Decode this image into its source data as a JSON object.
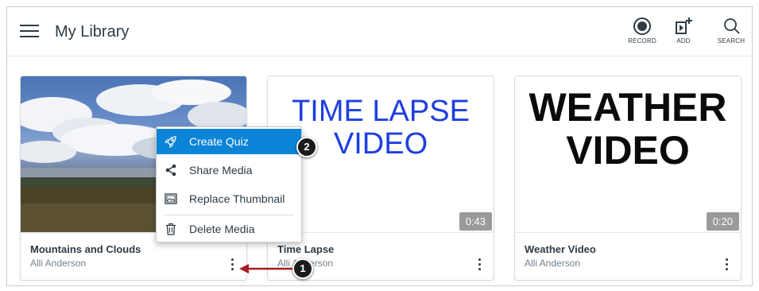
{
  "header": {
    "title": "My Library",
    "record_label": "RECORD",
    "add_label": "ADD",
    "search_label": "SEARCH"
  },
  "cards": [
    {
      "name": "Mountains and Clouds",
      "author": "Alli Anderson",
      "duration": ""
    },
    {
      "name": "Time Lapse",
      "author": "Alli Anderson",
      "duration": "0:43",
      "thumb_lines": [
        "TIME LAPSE",
        "VIDEO"
      ]
    },
    {
      "name": "Weather Video",
      "author": "Alli Anderson",
      "duration": "0:20",
      "thumb_lines": [
        "WEATHER",
        "VIDEO"
      ]
    }
  ],
  "menu": {
    "items": [
      {
        "label": "Create Quiz",
        "icon": "rocket-icon",
        "active": true
      },
      {
        "label": "Share Media",
        "icon": "share-icon",
        "active": false
      },
      {
        "label": "Replace Thumbnail",
        "icon": "image-icon",
        "active": false
      },
      {
        "label": "Delete Media",
        "icon": "trash-icon",
        "active": false
      }
    ]
  },
  "callouts": [
    "1",
    "2"
  ],
  "colors": {
    "accent": "#0a84d6",
    "text": "#2d3b45",
    "muted": "#73818c",
    "arrow": "#a51c24",
    "time_lapse_text": "#1f3fe0"
  }
}
